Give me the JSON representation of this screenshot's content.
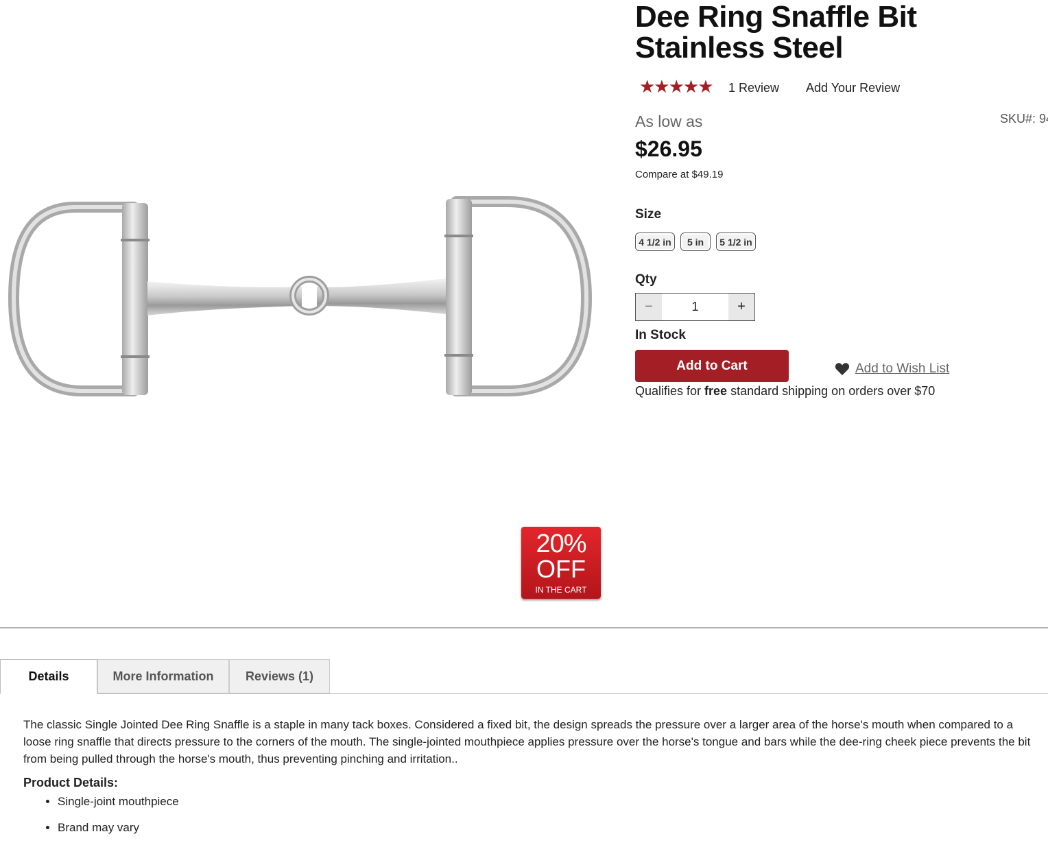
{
  "product": {
    "title": "Dee Ring Snaffle Bit Stainless Steel",
    "rating_stars": "★★★★★",
    "rating_value": 5,
    "review_count_label": "1  Review",
    "add_review_label": "Add Your Review",
    "price_prefix": "As low as",
    "price": "$26.95",
    "compare_price": "Compare at $49.19",
    "sku_label": "SKU#:  94"
  },
  "badge": {
    "percent": "20%",
    "off": "OFF",
    "note": "IN THE CART",
    "color": "#c91c22"
  },
  "options": {
    "size_label": "Size",
    "sizes": [
      "4 1/2 in",
      "5 in",
      "5 1/2 in"
    ],
    "qty_label": "Qty",
    "qty_value": "1",
    "qty_minus": "−",
    "qty_plus": "+"
  },
  "availability": "In Stock",
  "actions": {
    "add_to_cart": "Add to Cart",
    "wishlist": "Add to Wish List",
    "accent_color": "#a31f25"
  },
  "shipping": {
    "prefix": "Qualifies for ",
    "bold": "free",
    "suffix": " standard shipping on orders over $70"
  },
  "tabs": [
    {
      "label": "Details",
      "active": true
    },
    {
      "label": "More Information",
      "active": false
    },
    {
      "label": "Reviews (1)",
      "active": false
    }
  ],
  "details": {
    "description": "The classic Single Jointed Dee Ring Snaffle is a staple in many tack boxes. Considered a fixed bit, the design spreads the pressure over a larger area of the horse's mouth when compared to a loose ring snaffle that directs pressure to the corners of the mouth. The single-jointed mouthpiece applies pressure over the horse's tongue and bars while the dee-ring cheek piece prevents the bit from being pulled through the horse's mouth, thus preventing pinching and irritation..",
    "heading": "Product Details:",
    "items": [
      "Single-joint mouthpiece",
      "Brand may vary"
    ]
  }
}
